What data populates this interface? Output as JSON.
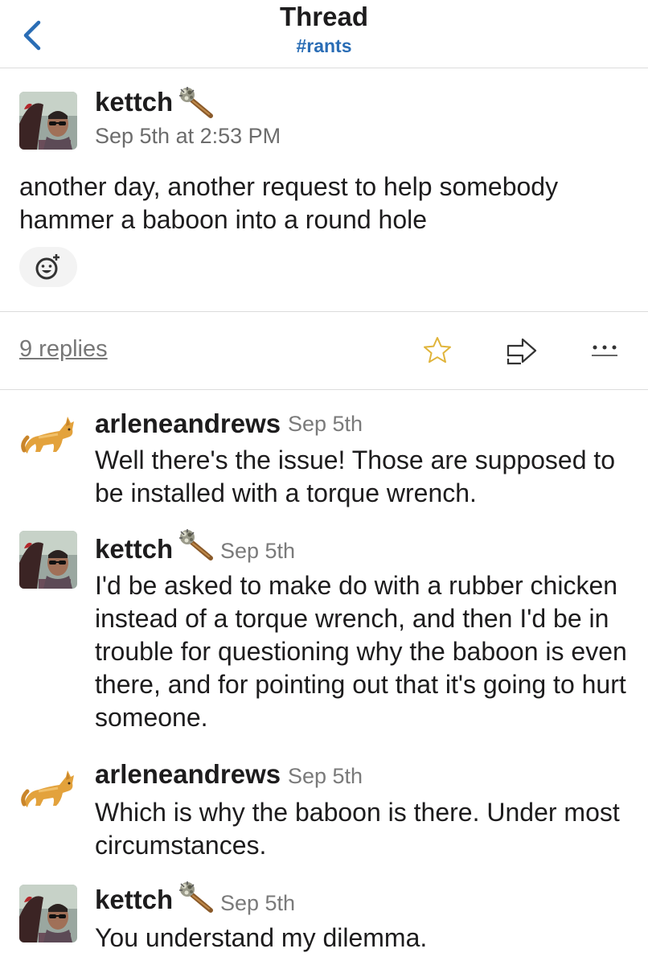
{
  "header": {
    "title": "Thread",
    "channel": "#rants",
    "back_icon": "chevron-left-icon"
  },
  "parent": {
    "author": "kettch",
    "timestamp": "Sep 5th at 2:53 PM",
    "text": "another day, another request to help somebody hammer a baboon into a round hole",
    "add_reaction_icon": "add-reaction-icon"
  },
  "actions": {
    "replies": "9 replies",
    "star_icon": "star-icon",
    "share_icon": "share-icon",
    "more_icon": "more-icon"
  },
  "replies": [
    {
      "author": "arleneandrews",
      "timestamp": "Sep 5th",
      "text": "Well there's the issue! Those are supposed to be installed with a torque wrench."
    },
    {
      "author": "kettch",
      "timestamp": "Sep 5th",
      "text": "I'd be asked to make do with a rubber chicken instead of a torque wrench, and then I'd be in trouble for questioning why the baboon is even there, and for pointing out that it's going to hurt someone."
    },
    {
      "author": "arleneandrews",
      "timestamp": "Sep 5th",
      "text": "Which is why the baboon is there. Under most circumstances."
    },
    {
      "author": "kettch",
      "timestamp": "Sep 5th",
      "text": "You understand my dilemma."
    }
  ],
  "colors": {
    "link": "#2a6db5",
    "star": "#e0b43a",
    "muted": "#7a7a7a"
  }
}
